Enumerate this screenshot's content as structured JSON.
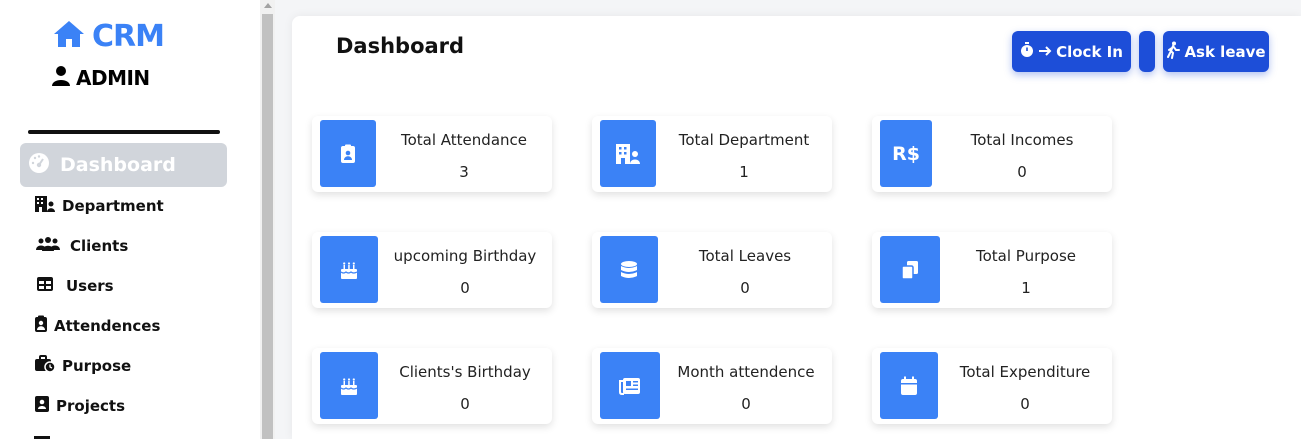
{
  "brand": {
    "name": "CRM",
    "user": "ADMIN"
  },
  "sidebar": {
    "active": {
      "label": "Dashboard"
    },
    "items": [
      {
        "label": "Department",
        "icon": "building-user-icon"
      },
      {
        "label": "Clients",
        "icon": "users-icon"
      },
      {
        "label": "Users",
        "icon": "table-icon"
      },
      {
        "label": "Attendences",
        "icon": "clipboard-user-icon"
      },
      {
        "label": "Purpose",
        "icon": "briefcase-clock-icon"
      },
      {
        "label": "Projects",
        "icon": "address-book-icon"
      }
    ]
  },
  "header": {
    "title": "Dashboard",
    "clock_in_label": "Clock In",
    "ask_leave_label": "Ask leave"
  },
  "cards": [
    {
      "title": "Total Attendance",
      "value": "3",
      "icon": "clipboard-user-icon"
    },
    {
      "title": "Total Department",
      "value": "1",
      "icon": "building-user-icon"
    },
    {
      "title": "Total Incomes",
      "value": "0",
      "icon": "real-currency-icon"
    },
    {
      "title": "upcoming Birthday",
      "value": "0",
      "icon": "cake-icon"
    },
    {
      "title": "Total Leaves",
      "value": "0",
      "icon": "database-icon"
    },
    {
      "title": "Total Purpose",
      "value": "1",
      "icon": "copy-icon"
    },
    {
      "title": "Clients's Birthday",
      "value": "0",
      "icon": "cake-icon"
    },
    {
      "title": "Month attendence",
      "value": "0",
      "icon": "newspaper-icon"
    },
    {
      "title": "Total Expenditure",
      "value": "0",
      "icon": "calendar-icon"
    }
  ],
  "colors": {
    "accent": "#3b82f6",
    "button": "#1d4ed8",
    "active_nav": "#d1d5db"
  }
}
